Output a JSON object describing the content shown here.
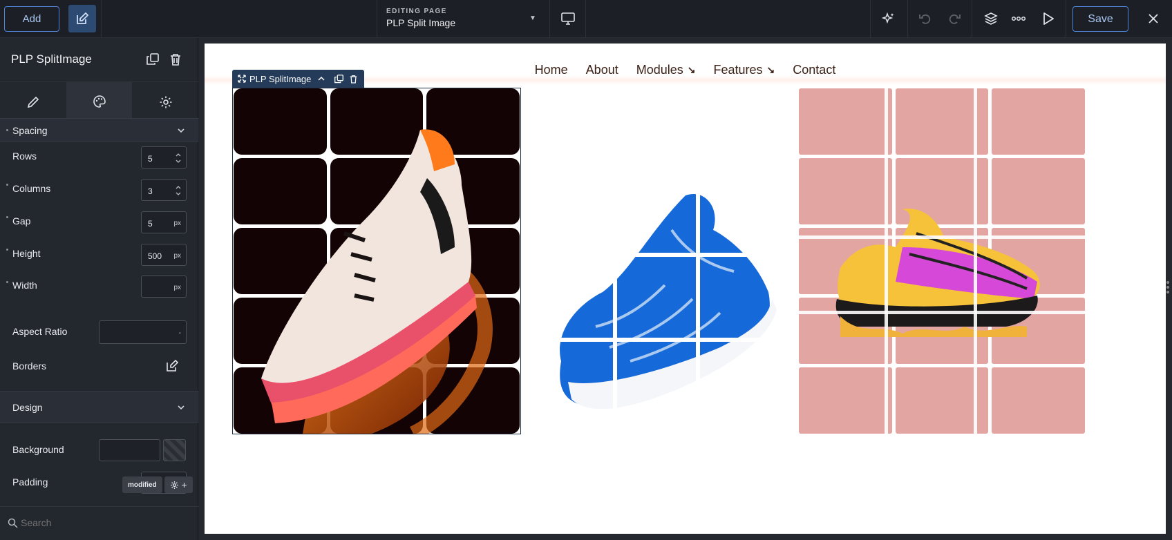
{
  "topbar": {
    "add_label": "Add",
    "editing_label": "EDITING PAGE",
    "editing_value": "PLP Split Image",
    "save_label": "Save"
  },
  "sidebar": {
    "component_title": "PLP SplitImage",
    "sections": {
      "spacing": "Spacing",
      "design": "Design"
    },
    "fields": {
      "rows": {
        "label": "Rows",
        "value": "5"
      },
      "columns": {
        "label": "Columns",
        "value": "3"
      },
      "gap": {
        "label": "Gap",
        "value": "5",
        "unit": "px"
      },
      "height": {
        "label": "Height",
        "value": "500",
        "unit": "px"
      },
      "width": {
        "label": "Width",
        "value": "",
        "unit": "px"
      },
      "aspect_ratio": {
        "label": "Aspect Ratio",
        "value": "-"
      },
      "borders": {
        "label": "Borders"
      },
      "background": {
        "label": "Background"
      },
      "padding": {
        "label": "Padding",
        "value": "",
        "unit": "px"
      }
    },
    "search_placeholder": "Search",
    "modified_badge": "modified"
  },
  "page": {
    "nav": [
      {
        "label": "Home"
      },
      {
        "label": "About"
      },
      {
        "label": "Modules",
        "arrow": "↘"
      },
      {
        "label": "Features",
        "arrow": "↘"
      },
      {
        "label": "Contact"
      }
    ],
    "component_toolbar_label": "PLP SplitImage",
    "split_images": [
      {
        "name": "sneaker-orange-dark",
        "rows": 5,
        "columns": 3,
        "tile_color": "#140304"
      },
      {
        "name": "sneaker-blue-white",
        "rows": 5,
        "columns": 3,
        "tile_color": "#ffffff"
      },
      {
        "name": "sneaker-pink-yellow",
        "rows": 5,
        "columns": 3,
        "tile_color": "#e3a5a2"
      }
    ]
  },
  "colors": {
    "accent": "#4f86d9",
    "sidebar_bg": "#23272e",
    "topbar_bg": "#1c1f26",
    "nav_text": "#3b2116"
  }
}
